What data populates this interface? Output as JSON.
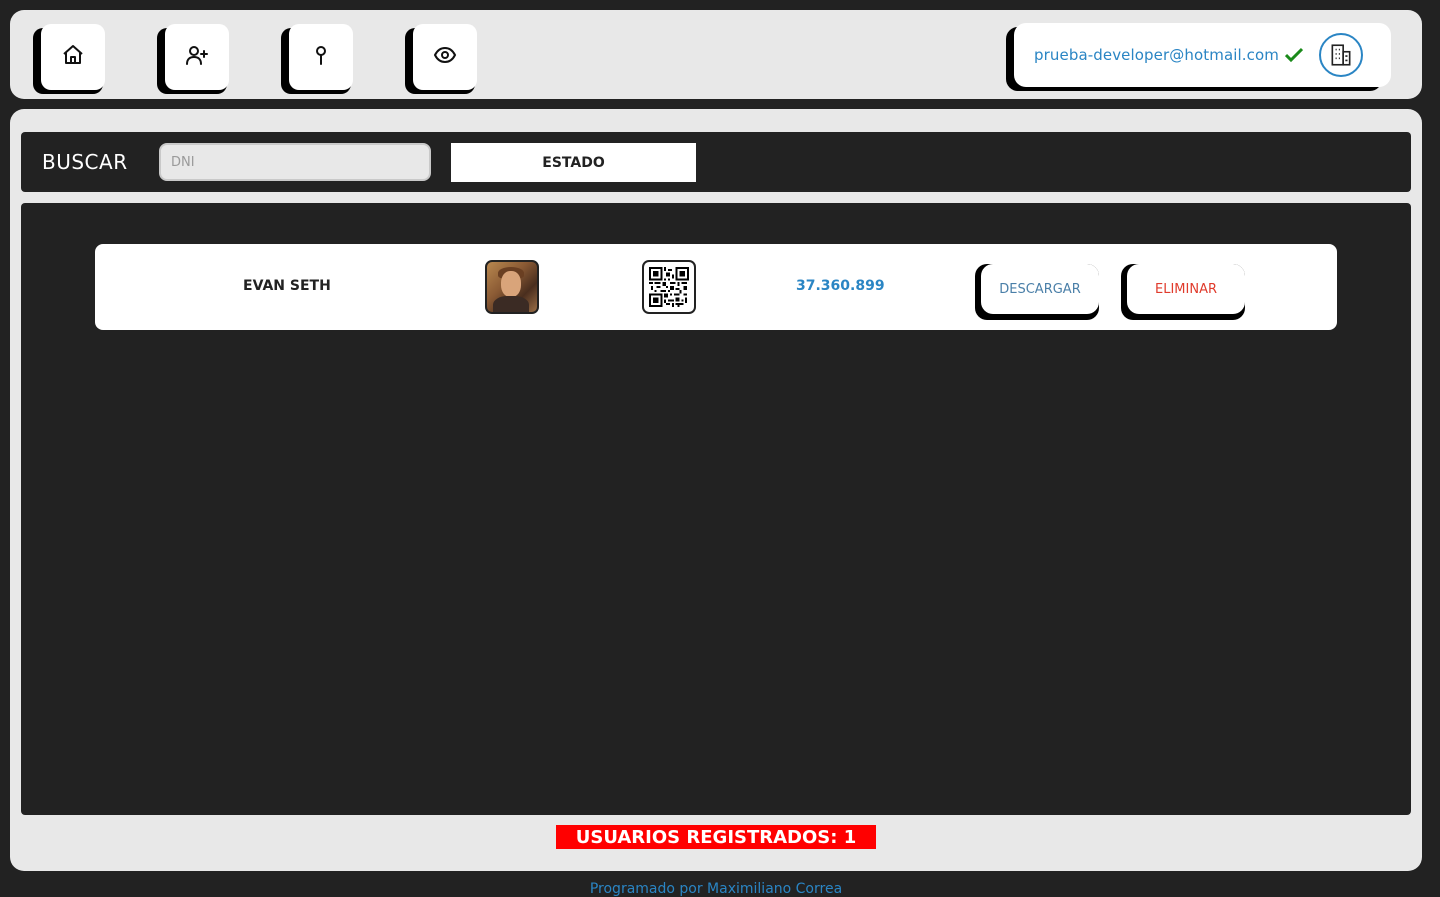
{
  "nav": {
    "buttons": [
      {
        "icon": "home-icon"
      },
      {
        "icon": "add-user-icon"
      },
      {
        "icon": "map-pin-icon"
      },
      {
        "icon": "eye-icon"
      }
    ]
  },
  "user": {
    "email": "prueba-developer@hotmail.com",
    "verified_icon": "check-icon",
    "org_icon": "building-icon"
  },
  "search": {
    "label": "BUSCAR",
    "placeholder": "DNI",
    "value": "",
    "estado_label": "ESTADO"
  },
  "rows": [
    {
      "name": "EVAN SETH",
      "dni": "37.360.899",
      "download_label": "DESCARGAR",
      "delete_label": "ELIMINAR"
    }
  ],
  "summary": {
    "registered_label": "USUARIOS REGISTRADOS: 1"
  },
  "footer": {
    "credit": "Programado por Maximiliano Correa"
  },
  "colors": {
    "accent": "#2a85c4",
    "danger": "#e03b2c",
    "badge": "#ff0000",
    "dark": "#222222",
    "panel": "#e8e8e8"
  }
}
